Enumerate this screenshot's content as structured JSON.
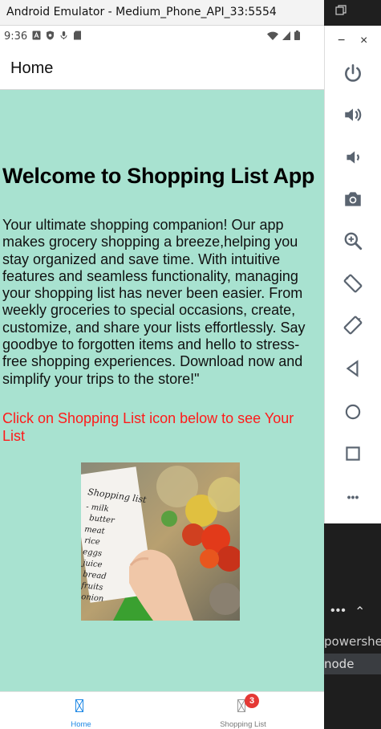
{
  "window": {
    "title": "Android Emulator - Medium_Phone_API_33:5554"
  },
  "status_bar": {
    "time": "9:36"
  },
  "app_bar": {
    "title": "Home"
  },
  "content": {
    "heading": "Welcome to Shopping List App",
    "body": "Your ultimate shopping companion! Our app makes grocery shopping a breeze,helping you stay organized and save time. With intuitive features and seamless functionality, managing your shopping list has never been easier. From weekly groceries to special occasions, create, customize, and share your lists effortlessly. Say goodbye to forgotten items and hello to stress-free shopping experiences. Download now and simplify your trips to the store!\"",
    "cta": "Click on Shopping List icon below to see Your List",
    "photo": {
      "note_title": "Shopping list",
      "note_items": [
        "- milk",
        "butter",
        "meat",
        "rice",
        "eggs",
        "juice",
        "bread",
        "fruits",
        "onion"
      ]
    }
  },
  "bottom_nav": {
    "items": [
      {
        "label": "Home",
        "active": true
      },
      {
        "label": "Shopping List",
        "active": false,
        "badge": "3"
      }
    ]
  },
  "side_toolbar": {
    "minimize": "−",
    "close": "×",
    "more": "•••"
  },
  "ide_panel": {
    "dots": "•••",
    "powershell": "powershell",
    "node": "node"
  },
  "colors": {
    "content_bg": "#a8e2d0",
    "cta": "#ff1a1a",
    "nav_active": "#1e88e5",
    "badge": "#e53935"
  }
}
